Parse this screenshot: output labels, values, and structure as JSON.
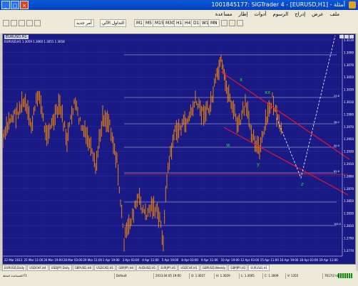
{
  "window": {
    "title": "1001845177: SIGTrader 4 - [EURUSD,H1] - أمثلة"
  },
  "menu": [
    "ملف",
    "عرض",
    "إدراج",
    "الرسوم",
    "أدوات",
    "إطار",
    "مساعدة"
  ],
  "toolbar": {
    "autotrade_label": "التداول الآلي",
    "new_order_label": "أمر جديد",
    "timeframes": [
      "M1",
      "M5",
      "M15",
      "M30",
      "H1",
      "H4",
      "D1",
      "W1",
      "MN"
    ]
  },
  "chart": {
    "window_title": "EURUSD,H1",
    "ohlc_text": "EURUSD,H1  1.3059 1.3060 1.3051 1.3058",
    "price_levels": [
      "1.3110",
      "1.3090",
      "1.3070",
      "1.3050",
      "1.3030",
      "1.3010",
      "1.2990",
      "1.2970",
      "1.2950",
      "1.2930",
      "1.2910",
      "1.2890",
      "1.2870",
      "1.2850",
      "1.2830",
      "1.2810",
      "1.2790",
      "1.2770"
    ],
    "fib_labels": [
      "23.6",
      "38.2",
      "50.0",
      "61.8",
      "100.0"
    ],
    "wave_labels": {
      "x": "x",
      "xx": "xx",
      "w": "w",
      "y": "y",
      "z": "z"
    },
    "date_labels": [
      "22 Mar 2013",
      "25 Mar 11:00",
      "26 Mar 19:00",
      "28 Mar 03:00",
      "29 Mar 11:00",
      "1 Apr 19:00",
      "3 Apr 03:00",
      "4 Apr 11:00",
      "5 Apr 19:00",
      "8 Apr 03:00",
      "9 Apr 11:00",
      "10 Apr 19:00",
      "12 Apr 03:00",
      "15 Apr 11:00",
      "16 Apr 19:00",
      "18 Apr 03:00",
      "19 Apr 11:00"
    ],
    "colors": {
      "background": "#1a1a86",
      "candles": "#ff8c00",
      "channel": "#e8132a",
      "labels": "#22dd22",
      "fib": "#c8c8e8"
    }
  },
  "tabs": [
    "EURUSD,Daily",
    "USDCHF,H4",
    "USDJPY,Daily",
    "GBPUSD,H4",
    "USDCAD,H1",
    "GBPJPY,H4",
    "AUDUSD,H1",
    "EURJPY,H1",
    "USDCHF,H1",
    "GBPUSD,Weekly",
    "GBPJPY,H1",
    "EURUSD,H1"
  ],
  "active_tab": "EURUSD,H1",
  "status": {
    "help": "للمساعدة اضغط F1",
    "profile": "Default",
    "datetime": "2013.04.05 19:00",
    "o": "O: 1.3027",
    "h": "H: 1.3029",
    "l": "L: 1.3005",
    "c": "C: 1.3009",
    "v": "V: 1355",
    "traffic": "7617/2 kb"
  }
}
